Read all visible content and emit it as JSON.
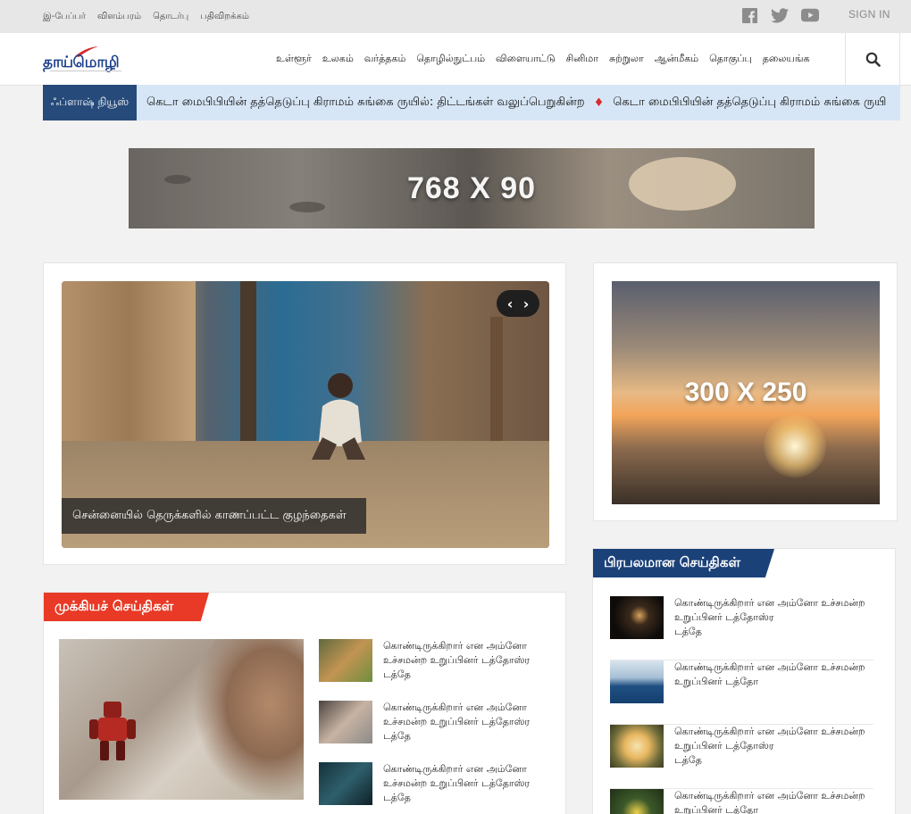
{
  "topbar": {
    "links": [
      "இ-பேப்பர்",
      "விளம்பரம்",
      "தொடர்பு",
      "பதிவிறக்கம்"
    ],
    "social": [
      "facebook-icon",
      "twitter-icon",
      "youtube-icon"
    ],
    "signin": "SIGN IN"
  },
  "header": {
    "logo": "தாய்மொழி",
    "nav": [
      "உள்ளூர்",
      "உலகம்",
      "வர்த்தகம்",
      "தொழில்நுட்பம்",
      "விளையாட்டு",
      "சினிமா",
      "சுற்றுலா",
      "ஆன்மீகம்",
      "தொகுப்பு",
      "தலையங்க"
    ]
  },
  "flash": {
    "label": "ஃப்ளாஷ் நியூஸ்",
    "items": [
      "கெடா மைபிபியின் தத்தெடுப்பு கிராமம் சுங்கை ருயில்: திட்டங்கள் வலுப்பெறுகின்ற",
      "கெடா மைபிபியின் தத்தெடுப்பு கிராமம் சுங்கை ருயி"
    ]
  },
  "ads": {
    "banner": "768 X 90",
    "side": "300 X 250"
  },
  "slider": {
    "caption": "சென்னையில் தெருக்களில் காணப்பட்ட குழந்தைகள்",
    "prev": "‹",
    "next": "›"
  },
  "important": {
    "title": "முக்கியச் செய்திகள்",
    "items": [
      {
        "l1": "கொண்டிருக்கிறார் என அம்னோ",
        "l2": "உச்சமன்ற உறுப்பினர் டத்தோஸ்ர",
        "l3": "டத்தே"
      },
      {
        "l1": "கொண்டிருக்கிறார் என அம்னோ",
        "l2": "உச்சமன்ற உறுப்பினர் டத்தோஸ்ர",
        "l3": "டத்தே"
      },
      {
        "l1": "கொண்டிருக்கிறார் என அம்னோ",
        "l2": "உச்சமன்ற உறுப்பினர் டத்தோஸ்ர",
        "l3": "டத்தே"
      }
    ]
  },
  "popular": {
    "title": "பிரபலமான செய்திகள்",
    "items": [
      {
        "l1": "கொண்டிருக்கிறார் என அம்னோ உச்சமன்ற",
        "l2": "உறுப்பினர் டத்தோஸ்ர",
        "l3": "டத்தே"
      },
      {
        "l1": "கொண்டிருக்கிறார் என அம்னோ உச்சமன்ற",
        "l2": "உறுப்பினர் டத்தோ",
        "l3": ""
      },
      {
        "l1": "கொண்டிருக்கிறார் என அம்னோ உச்சமன்ற",
        "l2": "உறுப்பினர் டத்தோஸ்ர",
        "l3": "டத்தே"
      },
      {
        "l1": "கொண்டிருக்கிறார் என அம்னோ உச்சமன்ற",
        "l2": "உறுப்பினர் டத்தோ",
        "l3": ""
      }
    ]
  },
  "colors": {
    "accent_red": "#e83a26",
    "brand_blue": "#1b4179",
    "flash_bg": "#d7e6f6"
  }
}
